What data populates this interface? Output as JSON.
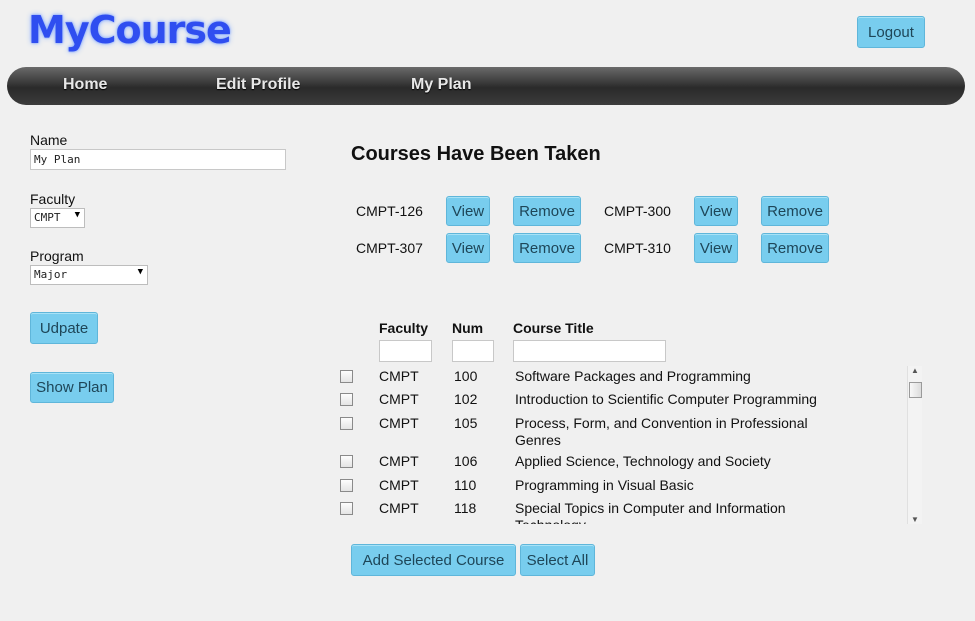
{
  "brand": {
    "logo": "MyCourse"
  },
  "header": {
    "logout_label": "Logout"
  },
  "nav": {
    "items": [
      {
        "label": "Home"
      },
      {
        "label": "Edit Profile"
      },
      {
        "label": "My Plan"
      }
    ]
  },
  "sidebar": {
    "name_label": "Name",
    "name_value": "My Plan",
    "faculty_label": "Faculty",
    "faculty_value": "CMPT",
    "program_label": "Program",
    "program_value": "Major",
    "update_label": "Udpate",
    "show_plan_label": "Show Plan"
  },
  "taken": {
    "heading": "Courses Have Been Taken",
    "view_label": "View",
    "remove_label": "Remove",
    "courses": [
      "CMPT-126",
      "CMPT-300",
      "CMPT-307",
      "CMPT-310"
    ]
  },
  "catalog": {
    "columns": {
      "faculty": "Faculty",
      "num": "Num",
      "title": "Course Title"
    },
    "rows": [
      {
        "faculty": "CMPT",
        "num": "100",
        "title": "Software Packages and Programming"
      },
      {
        "faculty": "CMPT",
        "num": "102",
        "title": "Introduction to Scientific Computer Programming"
      },
      {
        "faculty": "CMPT",
        "num": "105",
        "title": "Process, Form, and Convention in Professional Genres"
      },
      {
        "faculty": "CMPT",
        "num": "106",
        "title": "Applied Science, Technology and Society"
      },
      {
        "faculty": "CMPT",
        "num": "110",
        "title": "Programming in Visual Basic"
      },
      {
        "faculty": "CMPT",
        "num": "118",
        "title": "Special Topics in Computer and Information Technology"
      }
    ],
    "add_label": "Add Selected Course",
    "select_all_label": "Select All"
  },
  "colors": {
    "button": "#78cdee",
    "logo": "#2f4ef0",
    "nav_bg": "#333333"
  }
}
